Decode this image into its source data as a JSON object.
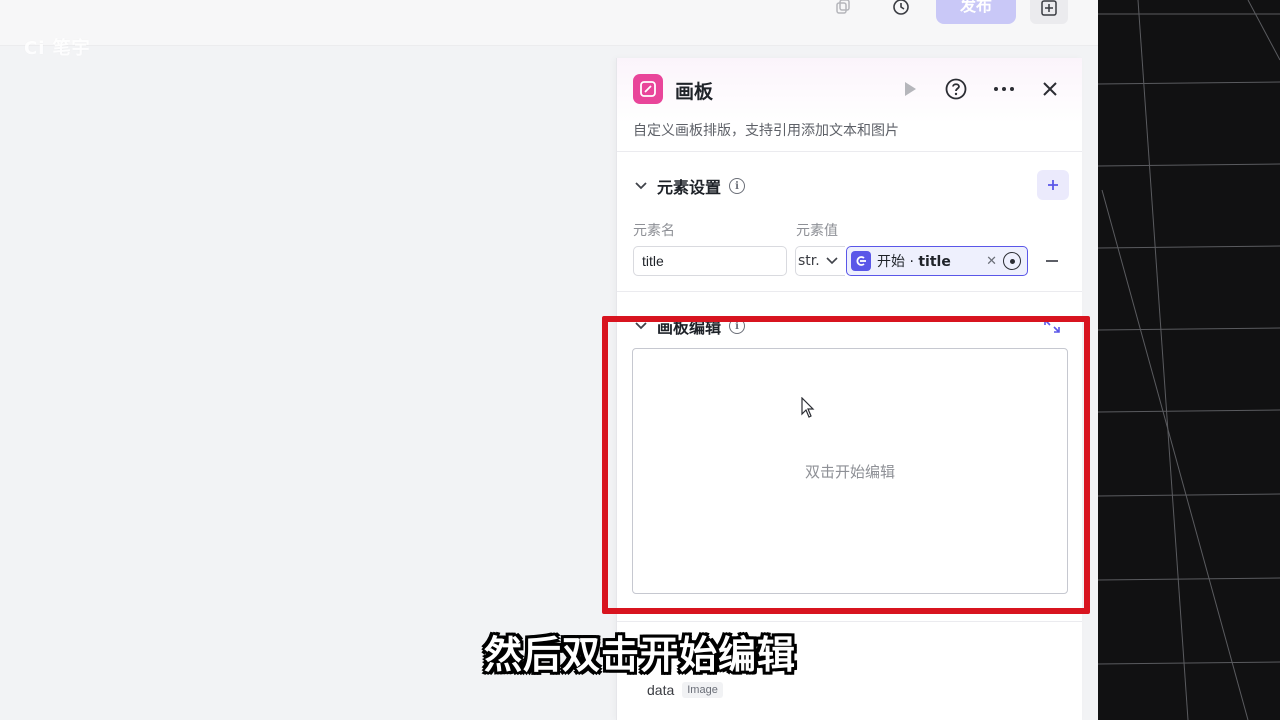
{
  "watermark": "Ci 笔宇",
  "toolbar": {
    "publish_label": "发布"
  },
  "panel": {
    "title": "画板",
    "description": "自定义画板排版，支持引用添加文本和图片",
    "element_settings": {
      "title": "元素设置",
      "name_label": "元素名",
      "value_label": "元素值",
      "name_value": "title",
      "type_value": "str.",
      "ref_source": "开始",
      "ref_separator": "·",
      "ref_field": "title"
    },
    "canvas_edit": {
      "title": "画板编辑",
      "hint": "双击开始编辑"
    },
    "output": {
      "name": "data",
      "type": "Image"
    }
  },
  "subtitle": "然后双击开始编辑",
  "colors": {
    "accent": "#5a57e8",
    "node_icon": "#e9459a",
    "highlight": "#d8141f"
  },
  "icons": [
    "copy-icon",
    "history-icon",
    "add-node-icon",
    "run-icon",
    "help-icon",
    "more-icon",
    "close-icon",
    "info-icon",
    "plus-icon",
    "minus-icon",
    "expand-icon",
    "cursor-icon"
  ]
}
